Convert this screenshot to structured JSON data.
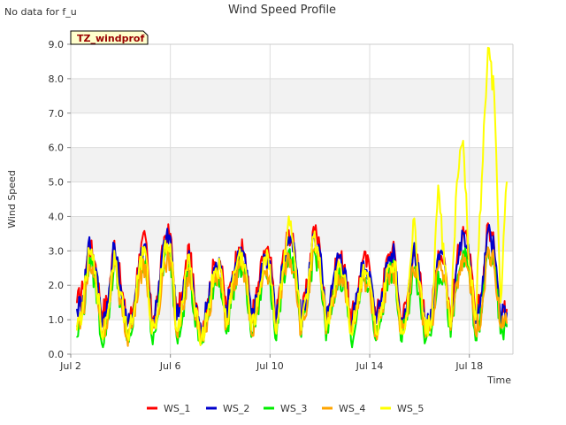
{
  "note": "No data for f_u",
  "chart_data": {
    "type": "line",
    "title": "Wind Speed Profile",
    "xlabel": "Time",
    "ylabel": "Wind Speed",
    "badge": "TZ_windprof",
    "ylim": [
      0,
      9
    ],
    "yticks": [
      "0.0",
      "1.0",
      "2.0",
      "3.0",
      "4.0",
      "5.0",
      "6.0",
      "7.0",
      "8.0",
      "9.0"
    ],
    "xlim": [
      "2023-07-02",
      "2023-07-19 18:00"
    ],
    "xticks": [
      {
        "label": "Jul 2",
        "date": "2023-07-02"
      },
      {
        "label": "Jul 6",
        "date": "2023-07-06"
      },
      {
        "label": "Jul 10",
        "date": "2023-07-10"
      },
      {
        "label": "Jul 14",
        "date": "2023-07-14"
      },
      {
        "label": "Jul 18",
        "date": "2023-07-18"
      }
    ],
    "grid": true,
    "legend": "bottom",
    "x": [
      "2023-07-02 06:00",
      "2023-07-02 12:00",
      "2023-07-02 18:00",
      "2023-07-03 00:00",
      "2023-07-03 06:00",
      "2023-07-03 12:00",
      "2023-07-03 18:00",
      "2023-07-04 00:00",
      "2023-07-04 06:00",
      "2023-07-04 12:00",
      "2023-07-04 18:00",
      "2023-07-05 00:00",
      "2023-07-05 06:00",
      "2023-07-05 12:00",
      "2023-07-05 18:00",
      "2023-07-06 00:00",
      "2023-07-06 06:00",
      "2023-07-06 12:00",
      "2023-07-06 18:00",
      "2023-07-07 00:00",
      "2023-07-07 06:00",
      "2023-07-07 12:00",
      "2023-07-07 18:00",
      "2023-07-08 00:00",
      "2023-07-08 06:00",
      "2023-07-08 12:00",
      "2023-07-08 18:00",
      "2023-07-09 00:00",
      "2023-07-09 06:00",
      "2023-07-09 12:00",
      "2023-07-09 18:00",
      "2023-07-10 00:00",
      "2023-07-10 06:00",
      "2023-07-10 12:00",
      "2023-07-10 18:00",
      "2023-07-11 00:00",
      "2023-07-11 06:00",
      "2023-07-11 12:00",
      "2023-07-11 18:00",
      "2023-07-12 00:00",
      "2023-07-12 06:00",
      "2023-07-12 12:00",
      "2023-07-12 18:00",
      "2023-07-13 00:00",
      "2023-07-13 06:00",
      "2023-07-13 12:00",
      "2023-07-13 18:00",
      "2023-07-14 00:00",
      "2023-07-14 06:00",
      "2023-07-14 12:00",
      "2023-07-14 18:00",
      "2023-07-15 00:00",
      "2023-07-15 06:00",
      "2023-07-15 12:00",
      "2023-07-15 18:00",
      "2023-07-16 00:00",
      "2023-07-16 06:00",
      "2023-07-16 12:00",
      "2023-07-16 18:00",
      "2023-07-17 00:00",
      "2023-07-17 06:00",
      "2023-07-17 12:00",
      "2023-07-17 18:00",
      "2023-07-18 00:00",
      "2023-07-18 06:00",
      "2023-07-18 12:00",
      "2023-07-18 18:00",
      "2023-07-19 00:00",
      "2023-07-19 06:00",
      "2023-07-19 12:00"
    ],
    "series": [
      {
        "name": "WS_1",
        "color": "#ff0000",
        "values": [
          1.5,
          1.9,
          3.2,
          2.6,
          1.2,
          1.6,
          3.3,
          2.1,
          0.9,
          1.3,
          2.9,
          3.4,
          1.0,
          1.7,
          3.4,
          3.5,
          1.1,
          1.8,
          3.2,
          1.4,
          0.7,
          1.6,
          2.6,
          2.7,
          1.3,
          2.4,
          3.1,
          2.9,
          1.1,
          1.8,
          3.0,
          2.8,
          1.0,
          2.7,
          3.6,
          3.0,
          1.0,
          2.0,
          3.7,
          3.1,
          1.0,
          2.0,
          2.9,
          2.6,
          0.9,
          1.8,
          2.8,
          2.5,
          1.0,
          1.9,
          2.9,
          3.0,
          0.9,
          1.6,
          3.1,
          2.4,
          0.8,
          1.3,
          3.0,
          2.8,
          1.0,
          2.7,
          3.7,
          2.9,
          1.0,
          1.8,
          3.8,
          3.1,
          1.2,
          1.3
        ]
      },
      {
        "name": "WS_2",
        "color": "#0000cc",
        "values": [
          1.3,
          1.7,
          3.4,
          2.5,
          1.0,
          1.5,
          3.2,
          2.0,
          0.8,
          1.2,
          2.7,
          3.2,
          0.9,
          1.6,
          3.3,
          3.4,
          1.0,
          1.7,
          3.0,
          1.3,
          0.6,
          1.5,
          2.5,
          2.6,
          1.2,
          2.3,
          3.0,
          2.8,
          1.0,
          1.7,
          2.9,
          2.7,
          0.9,
          2.6,
          3.4,
          2.9,
          0.9,
          1.9,
          3.5,
          3.0,
          0.9,
          1.9,
          2.8,
          2.5,
          0.8,
          1.7,
          2.7,
          2.4,
          0.9,
          1.8,
          2.8,
          2.9,
          0.8,
          1.5,
          3.0,
          2.3,
          0.7,
          1.2,
          2.9,
          2.7,
          0.9,
          2.6,
          3.5,
          2.8,
          0.9,
          1.7,
          3.6,
          3.0,
          1.1,
          1.2
        ]
      },
      {
        "name": "WS_3",
        "color": "#00ee00",
        "values": [
          0.5,
          1.2,
          2.8,
          2.0,
          0.3,
          1.0,
          2.7,
          1.5,
          0.4,
          0.8,
          2.3,
          2.7,
          0.5,
          1.1,
          2.8,
          2.9,
          0.5,
          1.2,
          2.6,
          0.8,
          0.3,
          1.0,
          2.1,
          2.2,
          0.6,
          1.8,
          2.5,
          2.3,
          0.5,
          1.2,
          2.4,
          2.2,
          0.4,
          2.1,
          3.0,
          2.4,
          0.5,
          1.4,
          3.0,
          2.5,
          0.4,
          1.4,
          2.3,
          2.0,
          0.4,
          1.2,
          2.2,
          1.9,
          0.4,
          1.3,
          2.3,
          2.4,
          0.4,
          1.0,
          2.5,
          1.8,
          0.4,
          0.8,
          2.4,
          2.2,
          0.5,
          2.0,
          3.0,
          2.3,
          0.4,
          1.2,
          3.1,
          2.5,
          0.6,
          0.8
        ]
      },
      {
        "name": "WS_4",
        "color": "#ffa500",
        "values": [
          0.8,
          1.3,
          2.6,
          2.1,
          0.6,
          1.1,
          2.6,
          1.6,
          0.5,
          0.9,
          2.3,
          2.6,
          0.6,
          1.2,
          2.7,
          2.8,
          0.6,
          1.3,
          2.5,
          1.0,
          0.4,
          1.1,
          2.1,
          2.2,
          0.8,
          1.9,
          2.5,
          2.3,
          0.6,
          1.3,
          2.4,
          2.3,
          0.6,
          2.2,
          2.9,
          2.4,
          0.6,
          1.5,
          3.0,
          2.5,
          0.6,
          1.5,
          2.3,
          2.1,
          0.6,
          1.3,
          2.2,
          2.0,
          0.6,
          1.4,
          2.3,
          2.4,
          0.6,
          1.1,
          2.5,
          1.9,
          0.5,
          0.9,
          2.5,
          2.3,
          0.7,
          2.1,
          2.9,
          2.4,
          0.6,
          1.3,
          3.1,
          2.6,
          0.8,
          0.9
        ]
      },
      {
        "name": "WS_5",
        "color": "#ffff00",
        "values": [
          0.7,
          1.4,
          3.0,
          2.4,
          0.5,
          1.3,
          3.0,
          1.8,
          0.6,
          1.0,
          2.6,
          3.0,
          0.6,
          1.3,
          3.1,
          3.2,
          0.7,
          1.5,
          2.9,
          1.1,
          0.5,
          1.2,
          2.4,
          2.5,
          0.8,
          2.1,
          2.9,
          2.6,
          0.7,
          1.4,
          2.8,
          2.6,
          0.6,
          2.4,
          4.0,
          2.7,
          0.7,
          1.6,
          3.4,
          2.8,
          0.7,
          1.6,
          2.7,
          2.3,
          0.6,
          1.4,
          2.6,
          2.2,
          0.6,
          1.5,
          2.6,
          2.7,
          0.6,
          1.2,
          3.9,
          2.1,
          0.6,
          1.1,
          4.9,
          2.6,
          0.8,
          5.0,
          6.2,
          2.6,
          1.0,
          5.1,
          8.9,
          7.5,
          1.5,
          5.0
        ]
      }
    ]
  }
}
